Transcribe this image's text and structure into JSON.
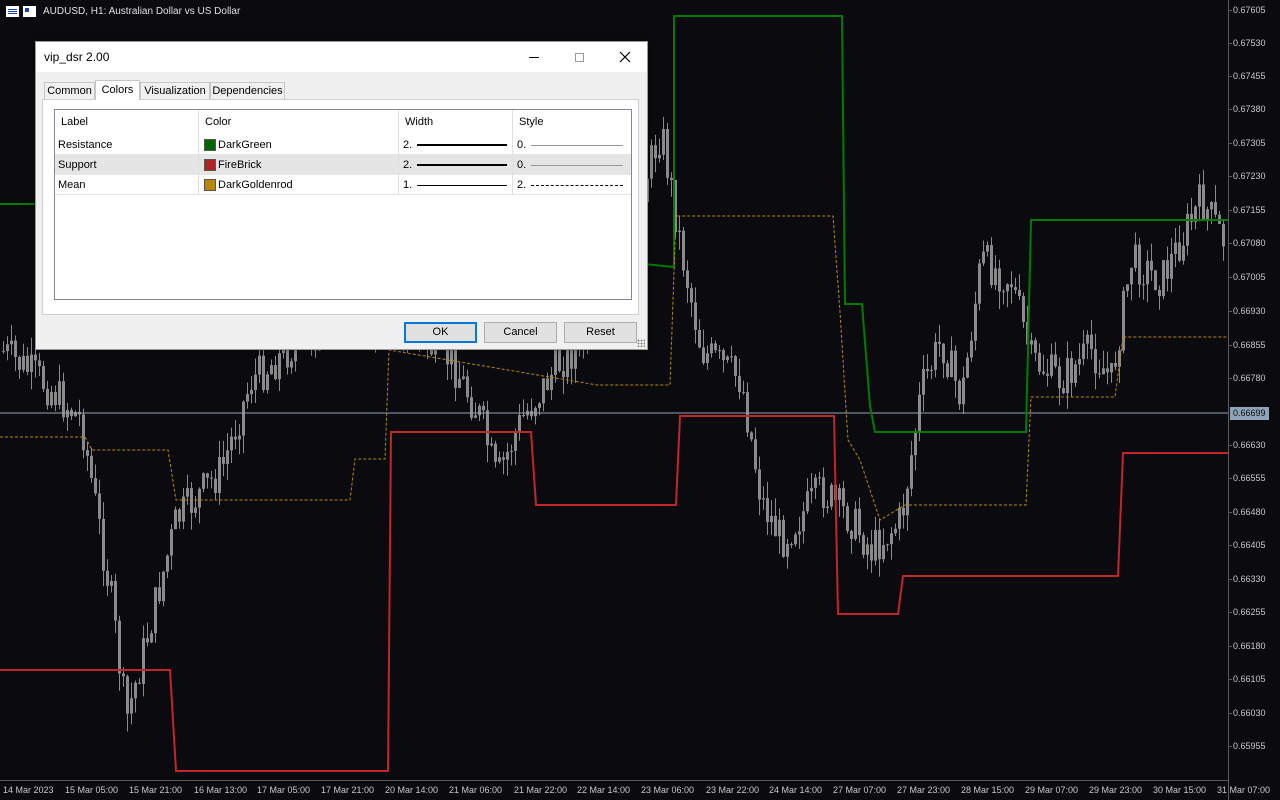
{
  "chart": {
    "symbol_title": "AUDUSD, H1:  Australian Dollar vs US Dollar",
    "current_price": "0.66699",
    "price_labels": [
      "0.67605",
      "0.67530",
      "0.67455",
      "0.67380",
      "0.67305",
      "0.67230",
      "0.67155",
      "0.67080",
      "0.67005",
      "0.66930",
      "0.66855",
      "0.66780",
      "0.66630",
      "0.66555",
      "0.66480",
      "0.66405",
      "0.66330",
      "0.66255",
      "0.66180",
      "0.66105",
      "0.66030",
      "0.65955"
    ],
    "time_labels": [
      "14 Mar 2023",
      "15 Mar 05:00",
      "15 Mar 21:00",
      "16 Mar 13:00",
      "17 Mar 05:00",
      "17 Mar 21:00",
      "20 Mar 14:00",
      "21 Mar 06:00",
      "21 Mar 22:00",
      "22 Mar 14:00",
      "23 Mar 06:00",
      "23 Mar 22:00",
      "24 Mar 14:00",
      "27 Mar 07:00",
      "27 Mar 23:00",
      "28 Mar 15:00",
      "29 Mar 07:00",
      "29 Mar 23:00",
      "30 Mar 15:00",
      "31 Mar 07:00"
    ],
    "colors": {
      "resistance": "#007a00",
      "support": "#c0262a",
      "mean": "#b8860b",
      "candle": "#8a8a8a",
      "price_line": "#8fa4b8"
    }
  },
  "dialog": {
    "title": "vip_dsr 2.00",
    "tabs": [
      {
        "label": "Common",
        "active": false
      },
      {
        "label": "Colors",
        "active": true
      },
      {
        "label": "Visualization",
        "active": false
      },
      {
        "label": "Dependencies",
        "active": false
      }
    ],
    "table": {
      "headers": {
        "label": "Label",
        "color": "Color",
        "width": "Width",
        "style": "Style"
      },
      "rows": [
        {
          "label": "Resistance",
          "color_name": "DarkGreen",
          "swatch": "#006400",
          "width": "2.",
          "style": "0.",
          "selected": false
        },
        {
          "label": "Support",
          "color_name": "FireBrick",
          "swatch": "#b22222",
          "width": "2.",
          "style": "0.",
          "selected": true
        },
        {
          "label": "Mean",
          "color_name": "DarkGoldenrod",
          "swatch": "#b8860b",
          "width": "1.",
          "style": "2.",
          "selected": false
        }
      ]
    },
    "buttons": {
      "ok": "OK",
      "cancel": "Cancel",
      "reset": "Reset"
    },
    "icons": {
      "minimize": "minimize-icon",
      "maximize": "maximize-icon",
      "close": "close-icon"
    }
  }
}
